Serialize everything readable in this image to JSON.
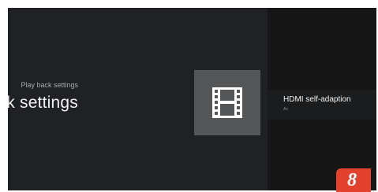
{
  "breadcrumb": "Play back settings",
  "page_title": "Play back settings",
  "icon": "movie-film-icon",
  "settings": [
    {
      "title": "HDMI self-adaption",
      "value": "An"
    }
  ],
  "badge": "8",
  "colors": {
    "left_pane": "#202124",
    "right_pane": "#161617",
    "icon_tile": "#545658",
    "badge": "#e2412e"
  }
}
